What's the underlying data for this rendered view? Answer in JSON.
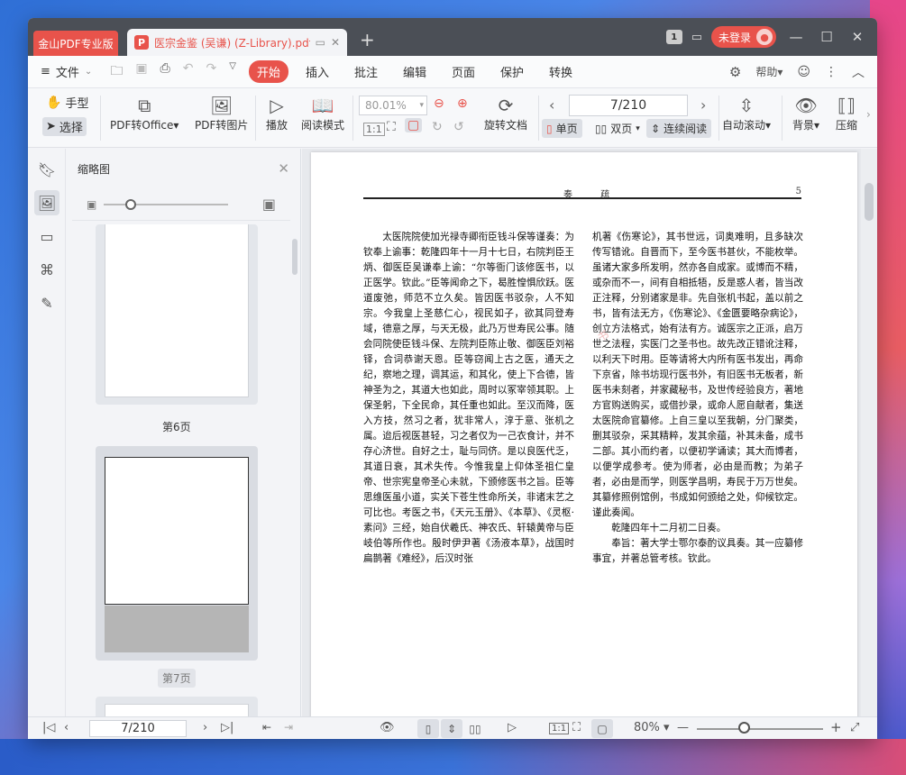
{
  "app": {
    "app_tab": "金山PDF专业版",
    "doc_tab": "医宗金鉴 (吴谦) (Z-Library).pdf",
    "badge": "1",
    "login": "未登录"
  },
  "menubar": {
    "file": "文件",
    "tabs": [
      "开始",
      "插入",
      "批注",
      "编辑",
      "页面",
      "保护",
      "转换"
    ],
    "help": "帮助"
  },
  "toolbar": {
    "hand": "手型",
    "select": "选择",
    "pdf_to_office": "PDF转Office",
    "pdf_to_image": "PDF转图片",
    "play": "播放",
    "read_mode": "阅读模式",
    "zoom": "80.01%",
    "rotate_doc": "旋转文档",
    "page": "7/210",
    "single": "单页",
    "double": "双页",
    "continuous": "连续阅读",
    "auto_scroll": "自动滚动",
    "background": "背景",
    "compress": "压缩"
  },
  "thumbs": {
    "title": "缩略图",
    "label6": "第6页",
    "label7": "第7页"
  },
  "doc": {
    "header_center": "奏 疏",
    "header_page": "5",
    "left_col": [
      "太医院院使加光禄寺卿衔臣钱斗保等谨奏：为钦奉上谕事：乾隆四年十一月十七日，右院判臣王炳、御医臣吴谦奉上谕：“尔等衙门该修医书，以正医学。钦此。”臣等闻命之下，曷胜惶惧欣跃。医道废弛，师范不立久矣。皆因医书驳杂，人不知宗。今我皇上圣慈仁心，视民如子，欲其同登寿域，德意之厚，与天无极，此乃万世寿民公事。随会同院使臣钱斗保、左院判臣陈止敬、御医臣刘裕铎，合词恭谢天恩。臣等窃闻上古之医，通天之纪，察地之理，调其运，和其化，使上下合德，皆神圣为之，其道大也如此，周时以冢宰领其职。上保圣躬，下全民命，其任重也如此。至汉而降，医入方技，然习之者，犹非常人，淳于意、张机之属。迨后视医甚轻，习之者仅为一己衣食计，并不存心济世。自好之士，耻与同侪。是以良医代乏，其道日衰，其术失传。今惟我皇上仰体圣祖仁皇帝、世宗宪皇帝圣心未就，下颁修医书之旨。臣等思维医虽小道，实关下苍生性命所关，非诸末艺之可比也。考医之书，《天元玉册》、《本草》、《灵枢·素问》三经，始自伏羲氏、神农氏、轩辕黄帝与臣岐伯等所作也。殷时伊尹著《汤液本草》，战国时扁鹊著《难经》，后汉时张"
    ],
    "right_col": [
      "机著《伤寒论》，其书世远，词奥难明，且多缺次传写错讹。自晋而下，至今医书甚伙，不能枚举。虽诸大家多所发明，然亦各自成家。或博而不精，或杂而不一，间有自相抵牾，反是惑人者，皆当改正注释，分别诸家是非。先自张机书起，盖以前之书，皆有法无方，《伤寒论》、《金匮要略杂病论》，创立方法格式，始有法有方。诚医宗之正派，启万世之法程，实医门之圣书也。故先改正错讹注释，以利天下时用。臣等请将大内所有医书发出，再命下京省，除书坊现行医书外，有旧医书无板者，新医书未刻者，并家藏秘书，及世传经验良方，著地方官购送购买，或借抄录，或命人愿自献者，集送太医院命官纂修。上自三皇以至我朝，分门聚类，删其驳杂，采其精粹，发其余蕴，补其未备，成书二部。其小而约者，以便初学诵读；其大而博者，以便学成参考。使为师者，必由是而教；为弟子者，必由是而学，则医学昌明，寿民于万万世矣。其纂修照例馆例，书成如何颁给之处，仰候钦定。谨此奏闻。",
      "乾隆四年十二月初二日奏。",
      "奉旨：著大学士鄂尔泰酌议具奏。其一应纂修事宜，并著总管考核。钦此。"
    ]
  },
  "status": {
    "page": "7/210",
    "zoom": "80%"
  }
}
